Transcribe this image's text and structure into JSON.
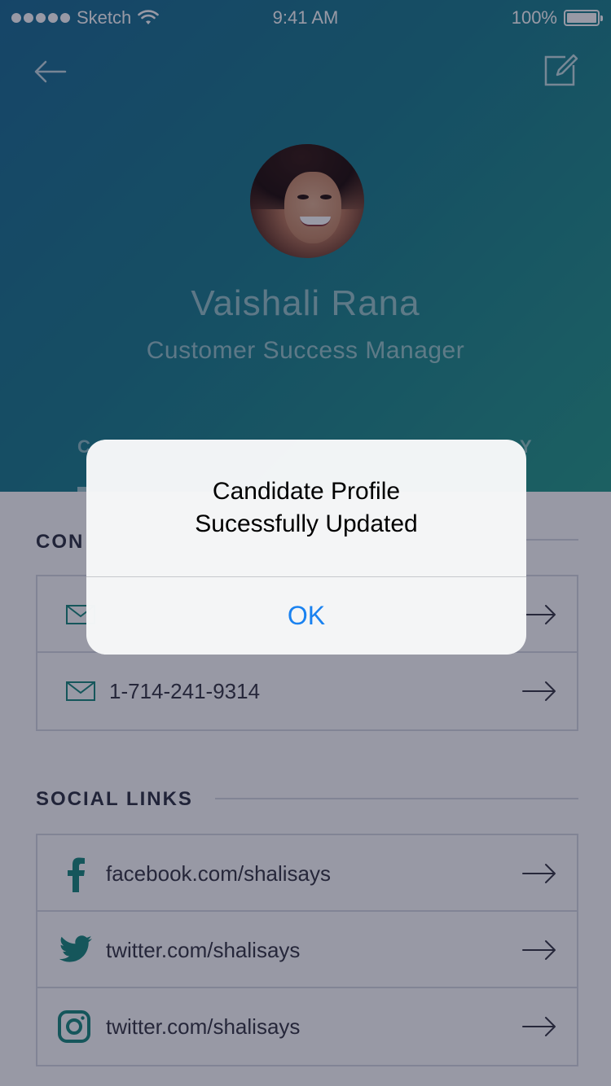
{
  "status_bar": {
    "carrier": "Sketch",
    "time": "9:41 AM",
    "battery": "100%"
  },
  "profile": {
    "name": "Vaishali Rana",
    "title": "Customer Success Manager"
  },
  "tabs": {
    "left_partial": "C",
    "right_partial": "Y"
  },
  "contact_section": {
    "heading_partial": "CON",
    "rows": [
      {
        "icon": "mail-icon",
        "text": ""
      },
      {
        "icon": "mail-icon",
        "text": "1-714-241-9314"
      }
    ]
  },
  "social_section": {
    "heading": "SOCIAL LINKS",
    "rows": [
      {
        "icon": "facebook-icon",
        "text": "facebook.com/shalisays"
      },
      {
        "icon": "twitter-icon",
        "text": "twitter.com/shalisays"
      },
      {
        "icon": "instagram-icon",
        "text": "twitter.com/shalisays"
      }
    ]
  },
  "alert": {
    "title_line1": "Candidate Profile",
    "title_line2": "Sucessfully Updated",
    "ok_label": "OK"
  },
  "colors": {
    "accent_teal": "#1e8c80",
    "ios_blue": "#1a82f0"
  }
}
